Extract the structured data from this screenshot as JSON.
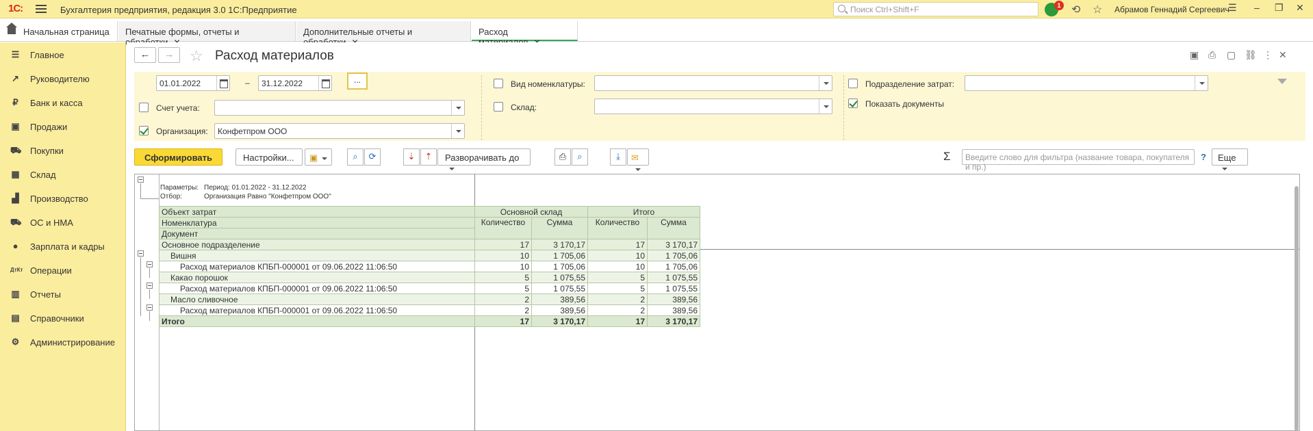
{
  "titlebar": {
    "logo": "1С:",
    "title": "Бухгалтерия предприятия, редакция 3.0 1С:Предприятие",
    "search_placeholder": "Поиск Ctrl+Shift+F",
    "notification_count": "1",
    "user": "Абрамов Геннадий Сергеевич"
  },
  "tabs": [
    {
      "label": "Начальная страница"
    },
    {
      "label": "Печатные формы, отчеты и обработки"
    },
    {
      "label": "Дополнительные отчеты и обработки"
    },
    {
      "label": "Расход материалов"
    }
  ],
  "sidebar": {
    "items": [
      {
        "label": "Главное",
        "icon": "menu-icon"
      },
      {
        "label": "Руководителю",
        "icon": "chart-line-icon"
      },
      {
        "label": "Банк и касса",
        "icon": "coin-icon"
      },
      {
        "label": "Продажи",
        "icon": "bag-icon"
      },
      {
        "label": "Покупки",
        "icon": "cart-icon"
      },
      {
        "label": "Склад",
        "icon": "warehouse-icon"
      },
      {
        "label": "Производство",
        "icon": "factory-icon"
      },
      {
        "label": "ОС и НМА",
        "icon": "truck-icon"
      },
      {
        "label": "Зарплата и кадры",
        "icon": "person-icon"
      },
      {
        "label": "Операции",
        "icon": "dt-kt-icon"
      },
      {
        "label": "Отчеты",
        "icon": "bar-chart-icon"
      },
      {
        "label": "Справочники",
        "icon": "book-icon"
      },
      {
        "label": "Администрирование",
        "icon": "gear-icon"
      }
    ]
  },
  "form": {
    "title": "Расход материалов"
  },
  "filters": {
    "date_from": "01.01.2022",
    "date_sep": "–",
    "date_to": "31.12.2022",
    "dots": "...",
    "account_label": "Счет учета:",
    "account_value": "",
    "org_label": "Организация:",
    "org_value": "Конфетпром ООО",
    "nomen_type_label": "Вид номенклатуры:",
    "nomen_type_value": "",
    "warehouse_label": "Склад:",
    "warehouse_value": "",
    "cost_dept_label": "Подразделение затрат:",
    "cost_dept_value": "",
    "show_docs_label": "Показать документы"
  },
  "toolbar": {
    "generate": "Сформировать",
    "settings": "Настройки...",
    "expand_to": "Разворачивать до",
    "filter_placeholder": "Введите слово для фильтра (название товара, покупателя и пр.)",
    "help": "?",
    "more": "Еще"
  },
  "report": {
    "params_label": "Параметры:",
    "params_value": "Период: 01.01.2022 - 31.12.2022",
    "filter_label": "Отбор:",
    "filter_value": "Организация Равно \"Конфетпром ООО\"",
    "headers": {
      "object": "Объект затрат",
      "nomenclature": "Номенклатура",
      "document": "Документ",
      "main_wh": "Основной склад",
      "total": "Итого",
      "qty": "Количество",
      "sum": "Сумма"
    },
    "rows": [
      {
        "name": "Основное подразделение",
        "q1": "17",
        "s1": "3 170,17",
        "q2": "17",
        "s2": "3 170,17"
      },
      {
        "name": "Вишня",
        "q1": "10",
        "s1": "1 705,06",
        "q2": "10",
        "s2": "1 705,06"
      },
      {
        "name": "Расход материалов КПБП-000001 от 09.06.2022 11:06:50",
        "q1": "10",
        "s1": "1 705,06",
        "q2": "10",
        "s2": "1 705,06"
      },
      {
        "name": "Какао порошок",
        "q1": "5",
        "s1": "1 075,55",
        "q2": "5",
        "s2": "1 075,55"
      },
      {
        "name": "Расход материалов КПБП-000001 от 09.06.2022 11:06:50",
        "q1": "5",
        "s1": "1 075,55",
        "q2": "5",
        "s2": "1 075,55"
      },
      {
        "name": "Масло сливочное",
        "q1": "2",
        "s1": "389,56",
        "q2": "2",
        "s2": "389,56"
      },
      {
        "name": "Расход материалов КПБП-000001 от 09.06.2022 11:06:50",
        "q1": "2",
        "s1": "389,56",
        "q2": "2",
        "s2": "389,56"
      }
    ],
    "total_row": {
      "name": "Итого",
      "q1": "17",
      "s1": "3 170,17",
      "q2": "17",
      "s2": "3 170,17"
    }
  }
}
